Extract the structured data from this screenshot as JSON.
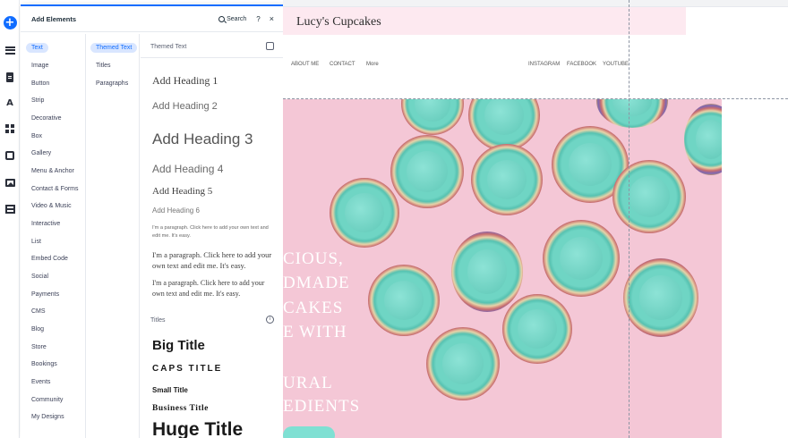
{
  "panel": {
    "title": "Add Elements",
    "search_label": "Search",
    "help_label": "?",
    "close_label": "×"
  },
  "categories": [
    "Text",
    "Image",
    "Button",
    "Strip",
    "Decorative",
    "Box",
    "Gallery",
    "Menu & Anchor",
    "Contact & Forms",
    "Video & Music",
    "Interactive",
    "List",
    "Embed Code",
    "Social",
    "Payments",
    "CMS",
    "Blog",
    "Store",
    "Bookings",
    "Events",
    "Community",
    "My Designs"
  ],
  "subcategories": [
    "Themed Text",
    "Titles",
    "Paragraphs"
  ],
  "themed_text": {
    "section_title": "Themed Text",
    "headings": [
      "Add Heading 1",
      "Add Heading 2",
      "Add Heading 3",
      "Add Heading 4",
      "Add Heading 5",
      "Add Heading 6"
    ],
    "paragraphs": [
      "I'm a paragraph. Click here to add your own text and edit me. It's easy.",
      "I'm a paragraph. Click here to add your own text and edit me. It's easy.",
      "I'm a paragraph. Click here to add your own text and edit me. It's easy."
    ]
  },
  "titles": {
    "section_title": "Titles",
    "info_icon": "i",
    "items": [
      "Big Title",
      "CAPS TITLE",
      "Small Title",
      "Business Title",
      "Huge Title"
    ]
  },
  "site": {
    "title": "Lucy's Cupcakes",
    "nav_left": [
      "ABOUT ME",
      "CONTACT",
      "More"
    ],
    "nav_right": [
      "INSTAGRAM",
      "FACEBOOK",
      "YOUTUBE"
    ],
    "hero_lines": [
      "CIOUS,",
      "DMADE",
      "CAKES",
      "E WITH",
      "URAL",
      "EDIENTS"
    ]
  },
  "icons": {
    "rail": [
      "add-icon",
      "menu-icon",
      "page-icon",
      "font-theme-icon",
      "apps-icon",
      "puzzle-icon",
      "media-icon",
      "table-icon"
    ]
  },
  "colors": {
    "accent": "#116dff",
    "header_pink": "#fde9f0",
    "hero_pink": "#f4c7d6",
    "frosting": "#6fd5c4"
  }
}
